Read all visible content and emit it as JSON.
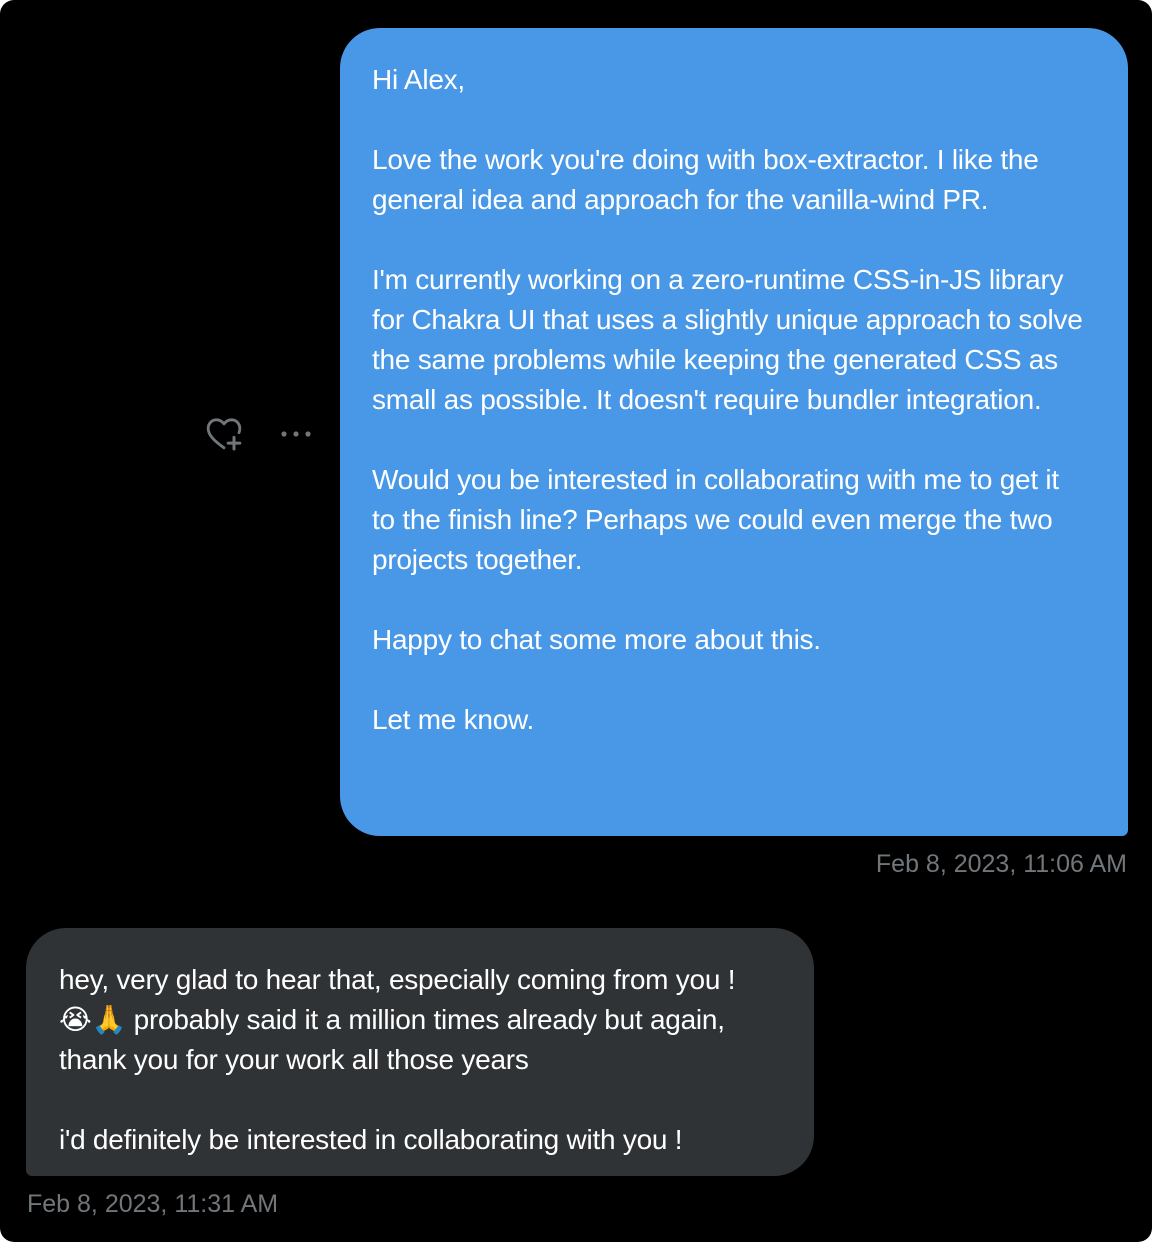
{
  "conversation": {
    "messages": [
      {
        "direction": "sent",
        "text": "Hi Alex,\n\nLove the work you're doing with box-extractor. I like the general idea and approach for the vanilla-wind PR.\n\nI'm currently working on a zero-runtime CSS-in-JS library for Chakra UI that uses a slightly unique approach to solve the same problems while keeping the generated CSS as small as possible. It doesn't require bundler integration.\n\nWould you be interested in collaborating with me to get it to the finish line? Perhaps we could even merge the two projects together.\n\nHappy to chat some more about this.\n\nLet me know.",
        "timestamp": "Feb 8, 2023, 11:06 AM"
      },
      {
        "direction": "received",
        "text_before_emoji": "hey, very glad to hear that, especially coming from you ! ",
        "emojis": "😭🙏",
        "text_after_emoji": " probably said it a million times already but again, thank you for your work all those years\n\ni'd definitely be interested in collaborating with you !",
        "timestamp": "Feb 8, 2023, 11:31 AM"
      }
    ]
  },
  "actions": {
    "react_icon": "heart-plus-icon",
    "more_icon": "more-horizontal-icon"
  },
  "colors": {
    "background": "#000000",
    "sent_bubble": "#4997e7",
    "received_bubble": "#2f3336",
    "timestamp": "#71767b",
    "icon": "#71767b"
  }
}
